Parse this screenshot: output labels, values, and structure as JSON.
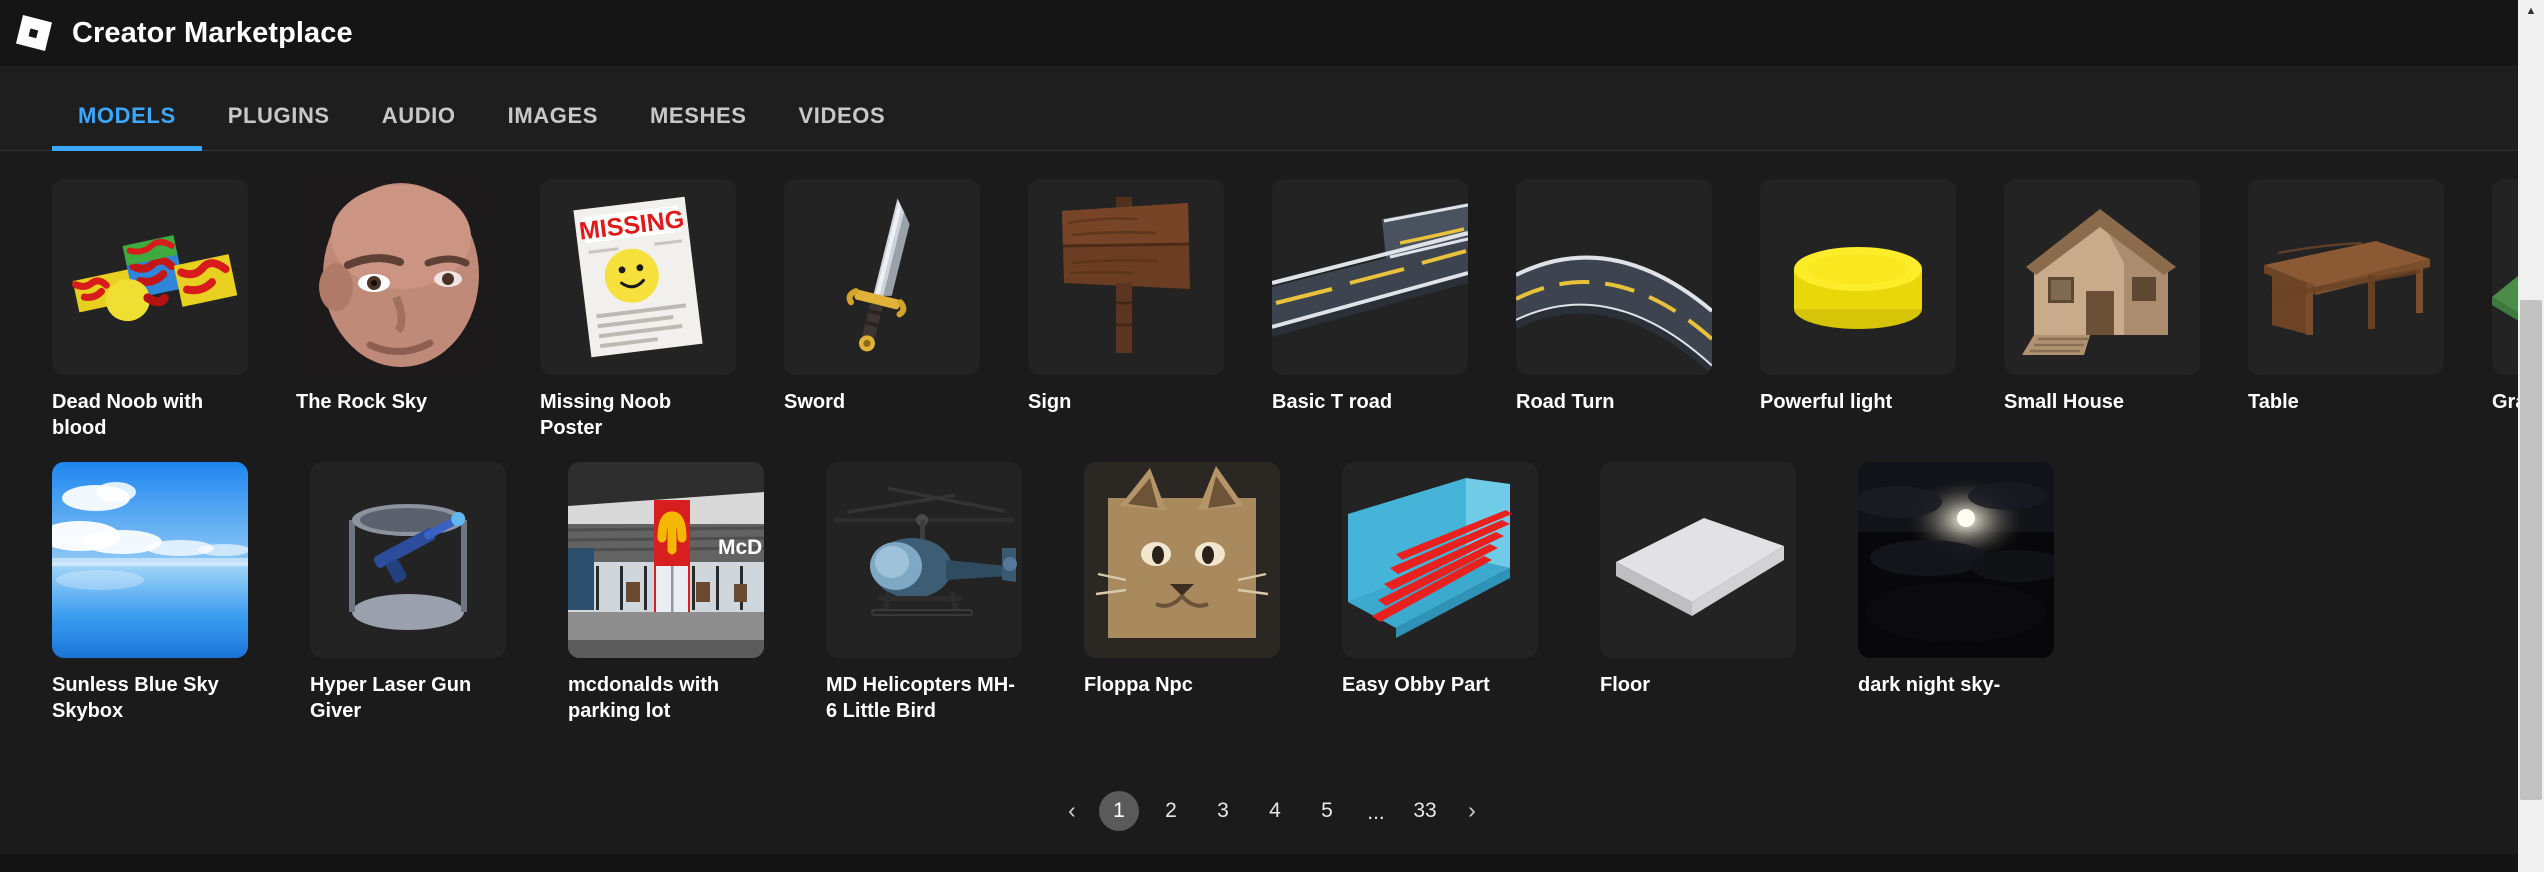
{
  "header": {
    "title": "Creator Marketplace",
    "logo_icon": "roblox-logo-icon"
  },
  "tabs": [
    {
      "id": "models",
      "label": "MODELS",
      "active": true
    },
    {
      "id": "plugins",
      "label": "PLUGINS",
      "active": false
    },
    {
      "id": "audio",
      "label": "AUDIO",
      "active": false
    },
    {
      "id": "images",
      "label": "IMAGES",
      "active": false
    },
    {
      "id": "meshes",
      "label": "MESHES",
      "active": false
    },
    {
      "id": "videos",
      "label": "VIDEOS",
      "active": false
    }
  ],
  "colors": {
    "accent": "#3ca7ff",
    "background": "#1b1b1b",
    "titlebar": "#151515",
    "tabbar": "#1e1e1e",
    "card": "#232323",
    "text": "#ffffff",
    "text_muted": "#c8c8c8",
    "page_active": "#5a5a5a",
    "scrollbar_track": "#f0f0f0",
    "scrollbar_thumb": "#c1c1c1"
  },
  "results": {
    "row1": [
      {
        "label": "Dead Noob with blood",
        "thumb": "noob-blood-thumb"
      },
      {
        "label": "The Rock Sky",
        "thumb": "rock-face-thumb"
      },
      {
        "label": "Missing Noob Poster",
        "thumb": "missing-poster-thumb"
      },
      {
        "label": "Sword",
        "thumb": "sword-thumb"
      },
      {
        "label": "Sign",
        "thumb": "wooden-sign-thumb"
      },
      {
        "label": "Basic T road",
        "thumb": "t-road-thumb"
      },
      {
        "label": "Road Turn",
        "thumb": "road-turn-thumb"
      },
      {
        "label": "Powerful light",
        "thumb": "yellow-light-thumb"
      },
      {
        "label": "Small House",
        "thumb": "small-house-thumb"
      },
      {
        "label": "Table",
        "thumb": "wooden-table-thumb"
      },
      {
        "label": "Grass Baseplate",
        "thumb": "grass-baseplate-thumb"
      }
    ],
    "row2": [
      {
        "label": "Sunless Blue Sky Skybox",
        "thumb": "blue-sky-thumb"
      },
      {
        "label": "Hyper Laser Gun Giver",
        "thumb": "laser-gun-giver-thumb"
      },
      {
        "label": "mcdonalds with parking lot",
        "thumb": "mcdonalds-thumb"
      },
      {
        "label": "MD Helicopters MH-6 Little Bird",
        "thumb": "helicopter-thumb"
      },
      {
        "label": "Floppa Npc",
        "thumb": "floppa-npc-thumb"
      },
      {
        "label": "Easy Obby Part",
        "thumb": "obby-stairs-thumb"
      },
      {
        "label": "Floor",
        "thumb": "floor-slab-thumb"
      },
      {
        "label": "dark night sky-",
        "thumb": "night-sky-thumb"
      }
    ]
  },
  "pagination": {
    "prev_label": "‹",
    "next_label": "›",
    "ellipsis": "...",
    "pages": [
      "1",
      "2",
      "3",
      "4",
      "5"
    ],
    "last_page": "33",
    "current": "1"
  }
}
